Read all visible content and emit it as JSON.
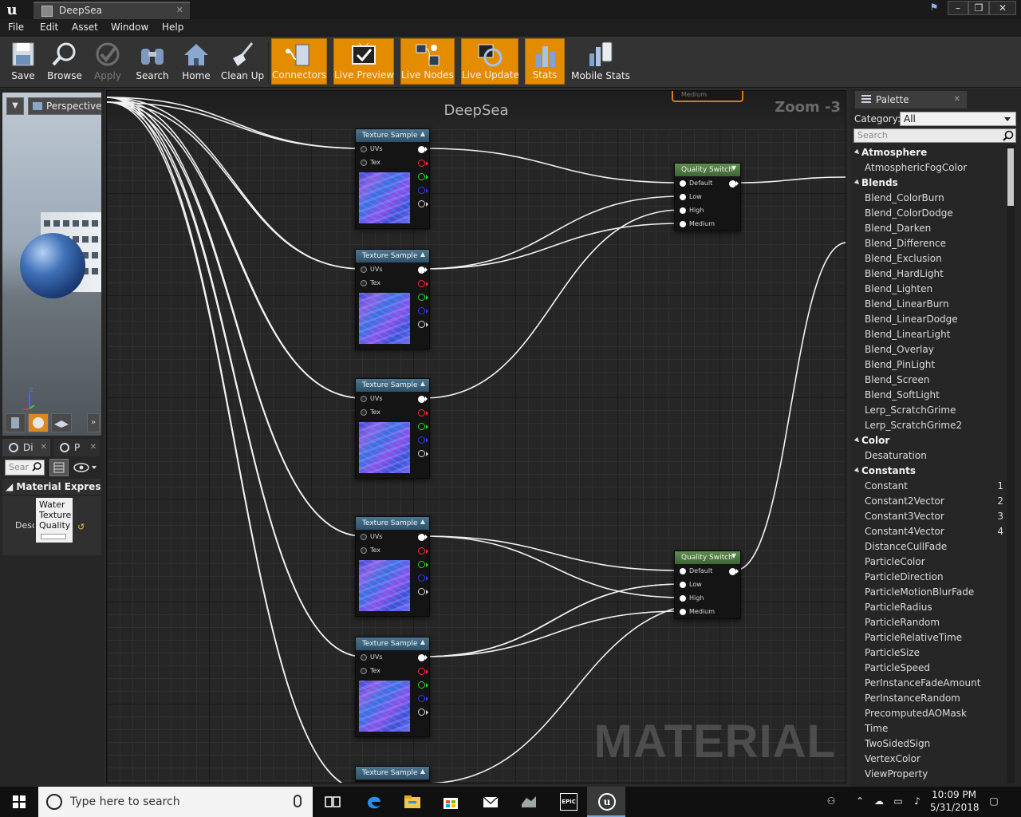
{
  "window": {
    "tab_title": "DeepSea"
  },
  "menu": [
    "File",
    "Edit",
    "Asset",
    "Window",
    "Help"
  ],
  "toolbar": {
    "buttons": [
      {
        "label": "Save",
        "icon": "save-icon"
      },
      {
        "label": "Browse",
        "icon": "browse-icon"
      },
      {
        "label": "Apply",
        "icon": "apply-icon"
      },
      {
        "label": "Search",
        "icon": "binoculars-icon"
      },
      {
        "label": "Home",
        "icon": "home-icon"
      },
      {
        "label": "Clean Up",
        "icon": "broom-icon"
      },
      {
        "label": "Connectors",
        "icon": "connectors-icon"
      },
      {
        "label": "Live Preview",
        "icon": "live-preview-icon"
      },
      {
        "label": "Live Nodes",
        "icon": "live-nodes-icon"
      },
      {
        "label": "Live Update",
        "icon": "live-update-icon"
      },
      {
        "label": "Stats",
        "icon": "stats-icon"
      },
      {
        "label": "Mobile Stats",
        "icon": "mobile-stats-icon"
      }
    ],
    "accent": "#e38c00"
  },
  "viewport": {
    "view_mode": "Perspective",
    "axis_label": "z"
  },
  "details": {
    "tabs": [
      "Di",
      "P"
    ],
    "search_placeholder": "Sear",
    "category": "Material Expressio",
    "row_label": "Desc",
    "row_value": [
      "Water",
      "Texture",
      "Quality"
    ]
  },
  "graph": {
    "title": "DeepSea",
    "zoom": "Zoom -3",
    "watermark": "MATERIAL",
    "stub_label": "Medium",
    "texture_nodes": [
      {
        "title": "Texture Sample",
        "pins": [
          "UVs",
          "Tex"
        ]
      },
      {
        "title": "Texture Sample",
        "pins": [
          "UVs",
          "Tex"
        ]
      },
      {
        "title": "Texture Sample",
        "pins": [
          "UVs",
          "Tex"
        ]
      },
      {
        "title": "Texture Sample",
        "pins": [
          "UVs",
          "Tex"
        ]
      },
      {
        "title": "Texture Sample",
        "pins": [
          "UVs",
          "Tex"
        ]
      },
      {
        "title": "Texture Sample",
        "pins": []
      }
    ],
    "switch_nodes": [
      {
        "title": "Quality Switch",
        "pins": [
          "Default",
          "Low",
          "High",
          "Medium"
        ]
      },
      {
        "title": "Quality Switch",
        "pins": [
          "Default",
          "Low",
          "High",
          "Medium"
        ]
      }
    ],
    "output_pin_colors": [
      "#ffffff",
      "#ff2a2a",
      "#2ad82a",
      "#2a3aff",
      "#d8d8d8"
    ]
  },
  "palette": {
    "tab": "Palette",
    "category_label": "Category:",
    "category_value": "All",
    "search_placeholder": "Search",
    "groups": [
      {
        "name": "Atmosphere",
        "items": [
          {
            "name": "AtmosphericFogColor"
          }
        ]
      },
      {
        "name": "Blends",
        "items": [
          {
            "name": "Blend_ColorBurn"
          },
          {
            "name": "Blend_ColorDodge"
          },
          {
            "name": "Blend_Darken"
          },
          {
            "name": "Blend_Difference"
          },
          {
            "name": "Blend_Exclusion"
          },
          {
            "name": "Blend_HardLight"
          },
          {
            "name": "Blend_Lighten"
          },
          {
            "name": "Blend_LinearBurn"
          },
          {
            "name": "Blend_LinearDodge"
          },
          {
            "name": "Blend_LinearLight"
          },
          {
            "name": "Blend_Overlay"
          },
          {
            "name": "Blend_PinLight"
          },
          {
            "name": "Blend_Screen"
          },
          {
            "name": "Blend_SoftLight"
          },
          {
            "name": "Lerp_ScratchGrime"
          },
          {
            "name": "Lerp_ScratchGrime2"
          }
        ]
      },
      {
        "name": "Color",
        "items": [
          {
            "name": "Desaturation"
          }
        ]
      },
      {
        "name": "Constants",
        "items": [
          {
            "name": "Constant",
            "hotkey": "1"
          },
          {
            "name": "Constant2Vector",
            "hotkey": "2"
          },
          {
            "name": "Constant3Vector",
            "hotkey": "3"
          },
          {
            "name": "Constant4Vector",
            "hotkey": "4"
          },
          {
            "name": "DistanceCullFade"
          },
          {
            "name": "ParticleColor"
          },
          {
            "name": "ParticleDirection"
          },
          {
            "name": "ParticleMotionBlurFade"
          },
          {
            "name": "ParticleRadius"
          },
          {
            "name": "ParticleRandom"
          },
          {
            "name": "ParticleRelativeTime"
          },
          {
            "name": "ParticleSize"
          },
          {
            "name": "ParticleSpeed"
          },
          {
            "name": "PerInstanceFadeAmount"
          },
          {
            "name": "PerInstanceRandom"
          },
          {
            "name": "PrecomputedAOMask"
          },
          {
            "name": "Time"
          },
          {
            "name": "TwoSidedSign"
          },
          {
            "name": "VertexColor"
          },
          {
            "name": "ViewProperty"
          }
        ]
      }
    ]
  },
  "taskbar": {
    "search_placeholder": "Type here to search",
    "apps": [
      "task-view-icon",
      "edge-icon",
      "file-explorer-icon",
      "store-icon",
      "mail-icon",
      "generic-app-icon",
      "epic-games-icon",
      "unreal-engine-icon"
    ],
    "epic_label": "EPIC",
    "time": "10:09 PM",
    "date": "5/31/2018"
  }
}
